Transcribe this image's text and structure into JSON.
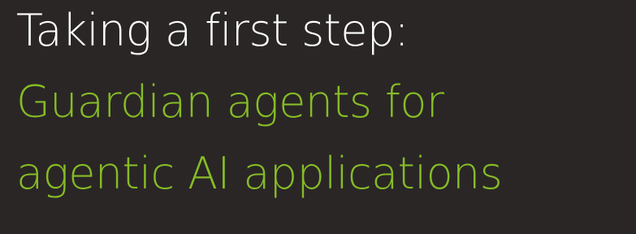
{
  "heading": {
    "line1": "Taking a first step:",
    "line2": "Guardian agents for",
    "line3": "agentic AI applications"
  },
  "colors": {
    "background": "#2a2626",
    "primary_text": "#ffffff",
    "accent": "#86bc25"
  }
}
